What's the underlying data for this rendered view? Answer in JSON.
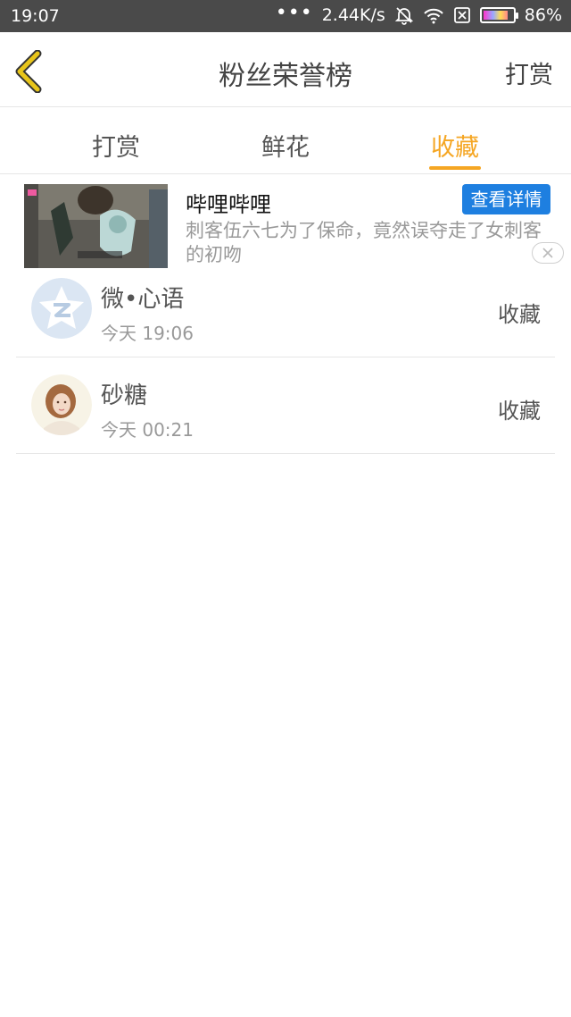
{
  "status_bar": {
    "time": "19:07",
    "more_dots": "•••",
    "net_speed": "2.44K/s",
    "battery_percent": "86%",
    "battery_level": 0.86,
    "icons": [
      "mute-icon",
      "wifi-icon",
      "sim-off-icon",
      "battery-icon"
    ]
  },
  "header": {
    "title": "粉丝荣誉榜",
    "action_label": "打赏",
    "back_icon": "chevron-left-icon"
  },
  "tabs": [
    {
      "label": "打赏",
      "active": false
    },
    {
      "label": "鲜花",
      "active": false
    },
    {
      "label": "收藏",
      "active": true
    }
  ],
  "ad": {
    "title": "哔哩哔哩",
    "description": "刺客伍六七为了保命，竟然误夺走了女刺客的初吻",
    "button_label": "查看详情",
    "close_icon": "close-icon"
  },
  "list": [
    {
      "name": "微•心语",
      "time": "今天 19:06",
      "status": "收藏",
      "avatar": "qzone-avatar"
    },
    {
      "name": "砂糖",
      "time": "今天 00:21",
      "status": "收藏",
      "avatar": "girl-photo-avatar"
    }
  ],
  "colors": {
    "accent": "#f5a623",
    "status_bar": "#4a4a4a",
    "ad_button": "#1e7fe0",
    "back_arrow": "#e8c51a"
  }
}
